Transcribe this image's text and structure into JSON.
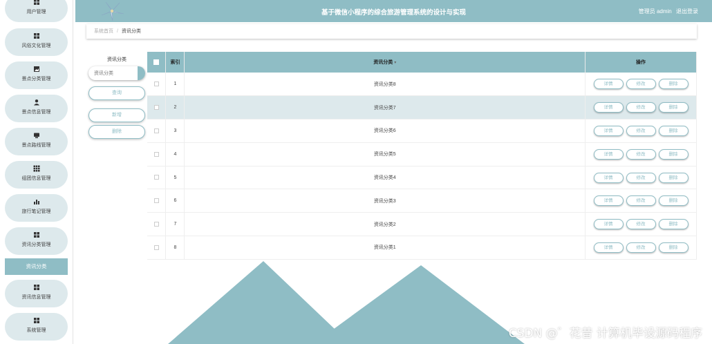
{
  "header": {
    "title": "基于微信小程序的综合旅游管理系统的设计与实现",
    "user_label": "管理员 admin",
    "logout_label": "退出登录"
  },
  "sidebar": {
    "items": [
      {
        "label": "用户管理",
        "icon": "grid-icon"
      },
      {
        "label": "风俗文化管理",
        "icon": "grid-icon"
      },
      {
        "label": "景点分类管理",
        "icon": "image-icon"
      },
      {
        "label": "景点信息管理",
        "icon": "user-icon"
      },
      {
        "label": "景点路线管理",
        "icon": "monitor-icon"
      },
      {
        "label": "组团信息管理",
        "icon": "apps-icon"
      },
      {
        "label": "旅行笔记管理",
        "icon": "bar-chart-icon"
      },
      {
        "label": "资讯分类管理",
        "icon": "grid-icon"
      },
      {
        "label": "资讯信息管理",
        "icon": "grid-icon"
      },
      {
        "label": "系统管理",
        "icon": "grid-icon"
      }
    ],
    "active_sub": "资讯分类"
  },
  "breadcrumb": {
    "home": "系统首页",
    "separator": "/",
    "current": "资讯分类"
  },
  "search": {
    "label": "资讯分类",
    "placeholder": "资讯分类",
    "query_button": "查询",
    "add_button": "新增",
    "delete_button": "删除"
  },
  "table": {
    "columns": [
      "索引",
      "资讯分类",
      "操作"
    ],
    "actions": [
      "详情",
      "修改",
      "删除"
    ],
    "rows": [
      {
        "index": "1",
        "name": "资讯分类8"
      },
      {
        "index": "2",
        "name": "资讯分类7"
      },
      {
        "index": "3",
        "name": "资讯分类6"
      },
      {
        "index": "4",
        "name": "资讯分类5"
      },
      {
        "index": "5",
        "name": "资讯分类4"
      },
      {
        "index": "6",
        "name": "资讯分类3"
      },
      {
        "index": "7",
        "name": "资讯分类2"
      },
      {
        "index": "8",
        "name": "资讯分类1"
      }
    ]
  },
  "watermark": "CSDN @゛花昔 计算机毕设源码程序",
  "colors": {
    "accent": "#8fbdc5",
    "accent_light": "#dde9ec"
  }
}
